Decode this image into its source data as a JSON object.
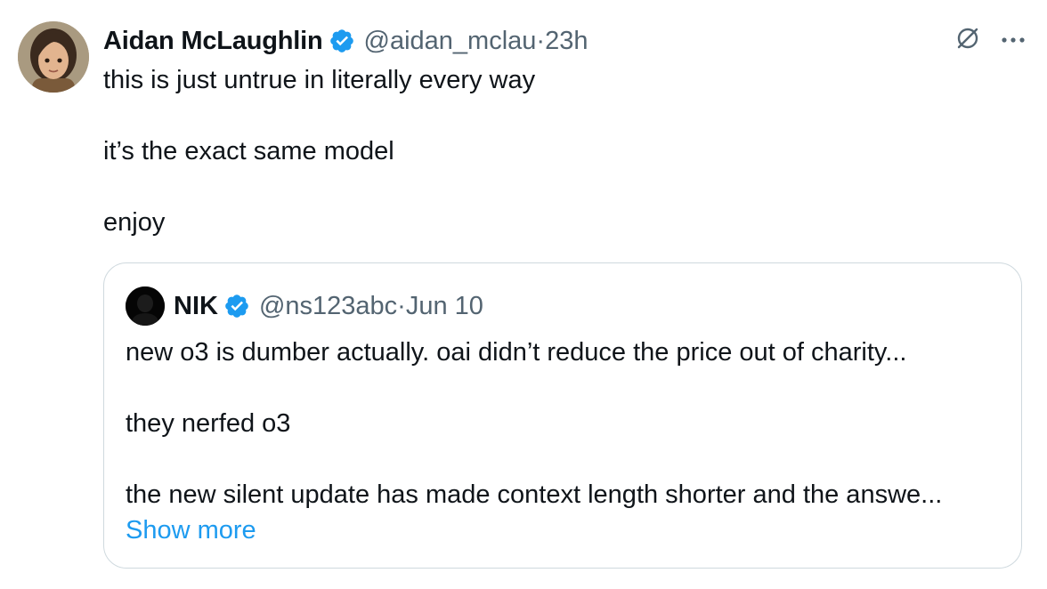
{
  "tweet": {
    "author_name": "Aidan McLaughlin",
    "handle": "@aidan_mclau",
    "separator": "·",
    "time": "23h",
    "lines": [
      "this is just untrue in literally every way",
      "it’s the exact same model",
      "enjoy"
    ]
  },
  "quoted": {
    "author_name": "NIK",
    "handle": "@ns123abc",
    "separator": "·",
    "date": "Jun 10",
    "lines": [
      "new o3 is dumber actually. oai didn’t reduce the price out of charity...",
      "they nerfed o3",
      "the new silent update has made context length shorter and the answe..."
    ],
    "show_more": "Show more"
  },
  "icons": {
    "verified": "verified-badge-icon",
    "grok": "grok-icon",
    "more": "more-icon"
  },
  "colors": {
    "verified": "#1d9bf0",
    "link": "#1d9bf0",
    "secondary_text": "#536471",
    "border": "#cfd9de"
  }
}
